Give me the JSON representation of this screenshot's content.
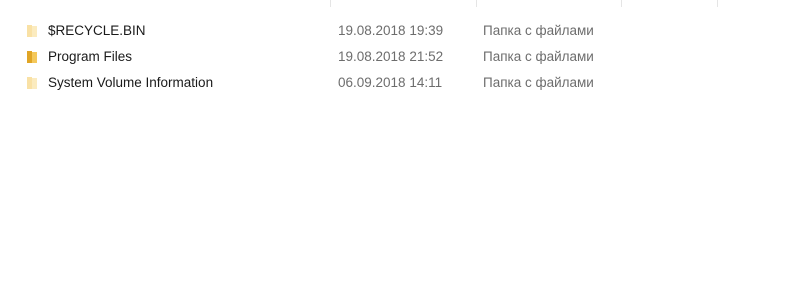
{
  "colors": {
    "folder_body": "#F4C85B",
    "folder_dark": "#E0A526",
    "text_primary": "#1A1A1A",
    "text_secondary": "#6D6D6D",
    "column_divider": "#E5E5E5"
  },
  "files": [
    {
      "name": "$RECYCLE.BIN",
      "date_modified": "19.08.2018 19:39",
      "type": "Папка с файлами",
      "icon": "folder-faded-icon"
    },
    {
      "name": "Program Files",
      "date_modified": "19.08.2018 21:52",
      "type": "Папка с файлами",
      "icon": "folder-icon"
    },
    {
      "name": "System Volume Information",
      "date_modified": "06.09.2018 14:11",
      "type": "Папка с файлами",
      "icon": "folder-faded-icon"
    }
  ]
}
